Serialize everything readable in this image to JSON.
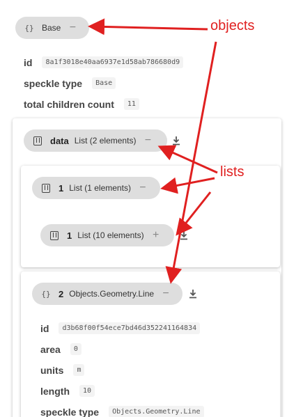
{
  "root": {
    "icon": "{}",
    "label": "Base",
    "toggle": "−",
    "props": {
      "id_key": "id",
      "id_val": "8a1f3018e40aa6937e1d58ab786680d9",
      "type_key": "speckle type",
      "type_val": "Base",
      "count_key": "total children count",
      "count_val": "11"
    }
  },
  "data_node": {
    "name": "data",
    "label": "List (2 elements)",
    "toggle": "−"
  },
  "list1_node": {
    "name": "1",
    "label": "List (1 elements)",
    "toggle": "−"
  },
  "list10_node": {
    "name": "1",
    "label": "List (10 elements)",
    "toggle": "+"
  },
  "line_node": {
    "icon": "{}",
    "name": "2",
    "label": "Objects.Geometry.Line",
    "toggle": "−",
    "props": {
      "id_key": "id",
      "id_val": "d3b68f00f54ece7bd46d352241164834",
      "area_key": "area",
      "area_val": "0",
      "units_key": "units",
      "units_val": "m",
      "length_key": "length",
      "length_val": "10",
      "type_key": "speckle type",
      "type_val": "Objects.Geometry.Line"
    }
  },
  "annotations": {
    "objects": "objects",
    "lists": "lists",
    "color": "#e02020"
  },
  "icons": {
    "download": "download-icon",
    "list": "list-icon",
    "object": "braces-icon"
  }
}
